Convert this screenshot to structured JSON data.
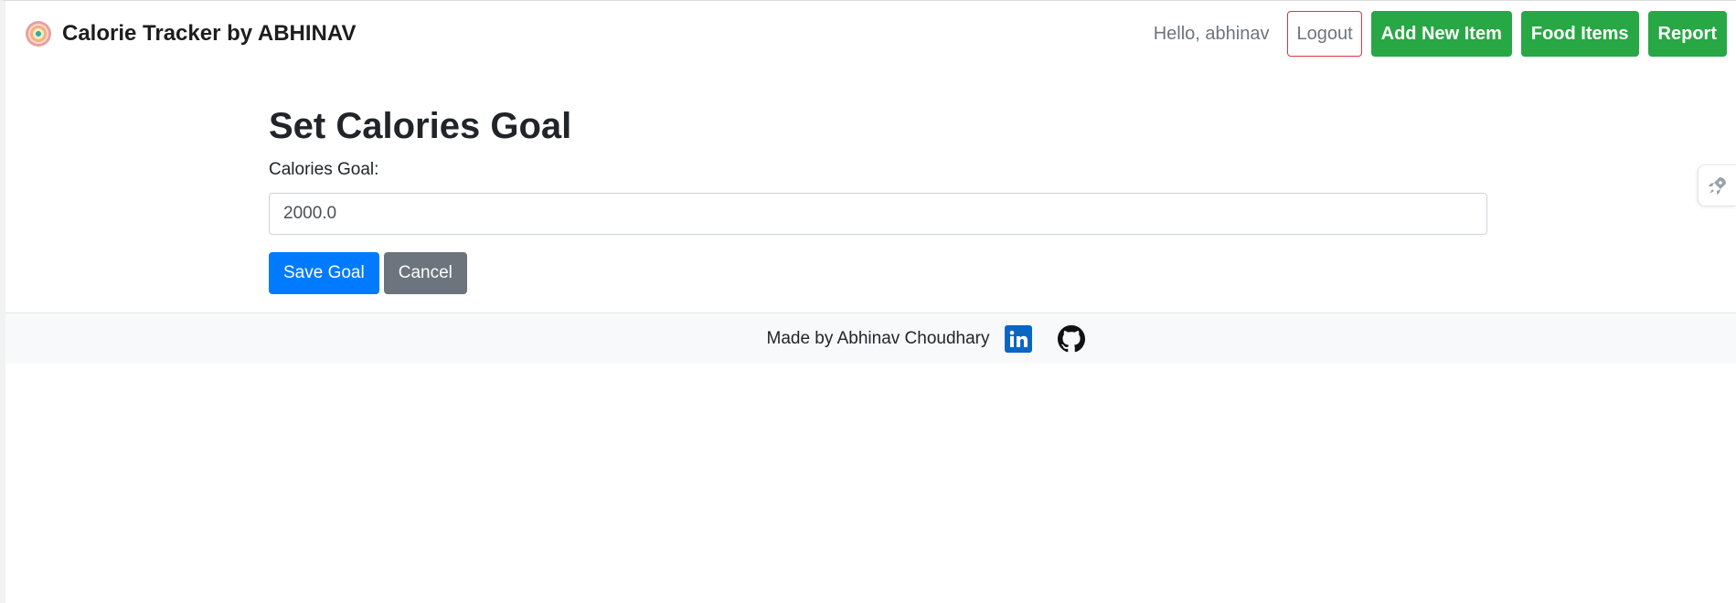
{
  "navbar": {
    "brand": "Calorie Tracker by ABHINAV",
    "greeting": "Hello, abhinav",
    "logout_label": "Logout",
    "add_item_label": "Add New Item",
    "food_items_label": "Food Items",
    "report_label": "Report"
  },
  "main": {
    "title": "Set Calories Goal",
    "field_label": "Calories Goal:",
    "goal_value": "2000.0",
    "save_label": "Save Goal",
    "cancel_label": "Cancel"
  },
  "footer": {
    "text": "Made by Abhinav Choudhary",
    "icons": [
      "linkedin-icon",
      "github-icon"
    ]
  },
  "colors": {
    "primary": "#007bff",
    "success": "#28a745",
    "secondary": "#6c757d",
    "danger": "#dc3545"
  }
}
